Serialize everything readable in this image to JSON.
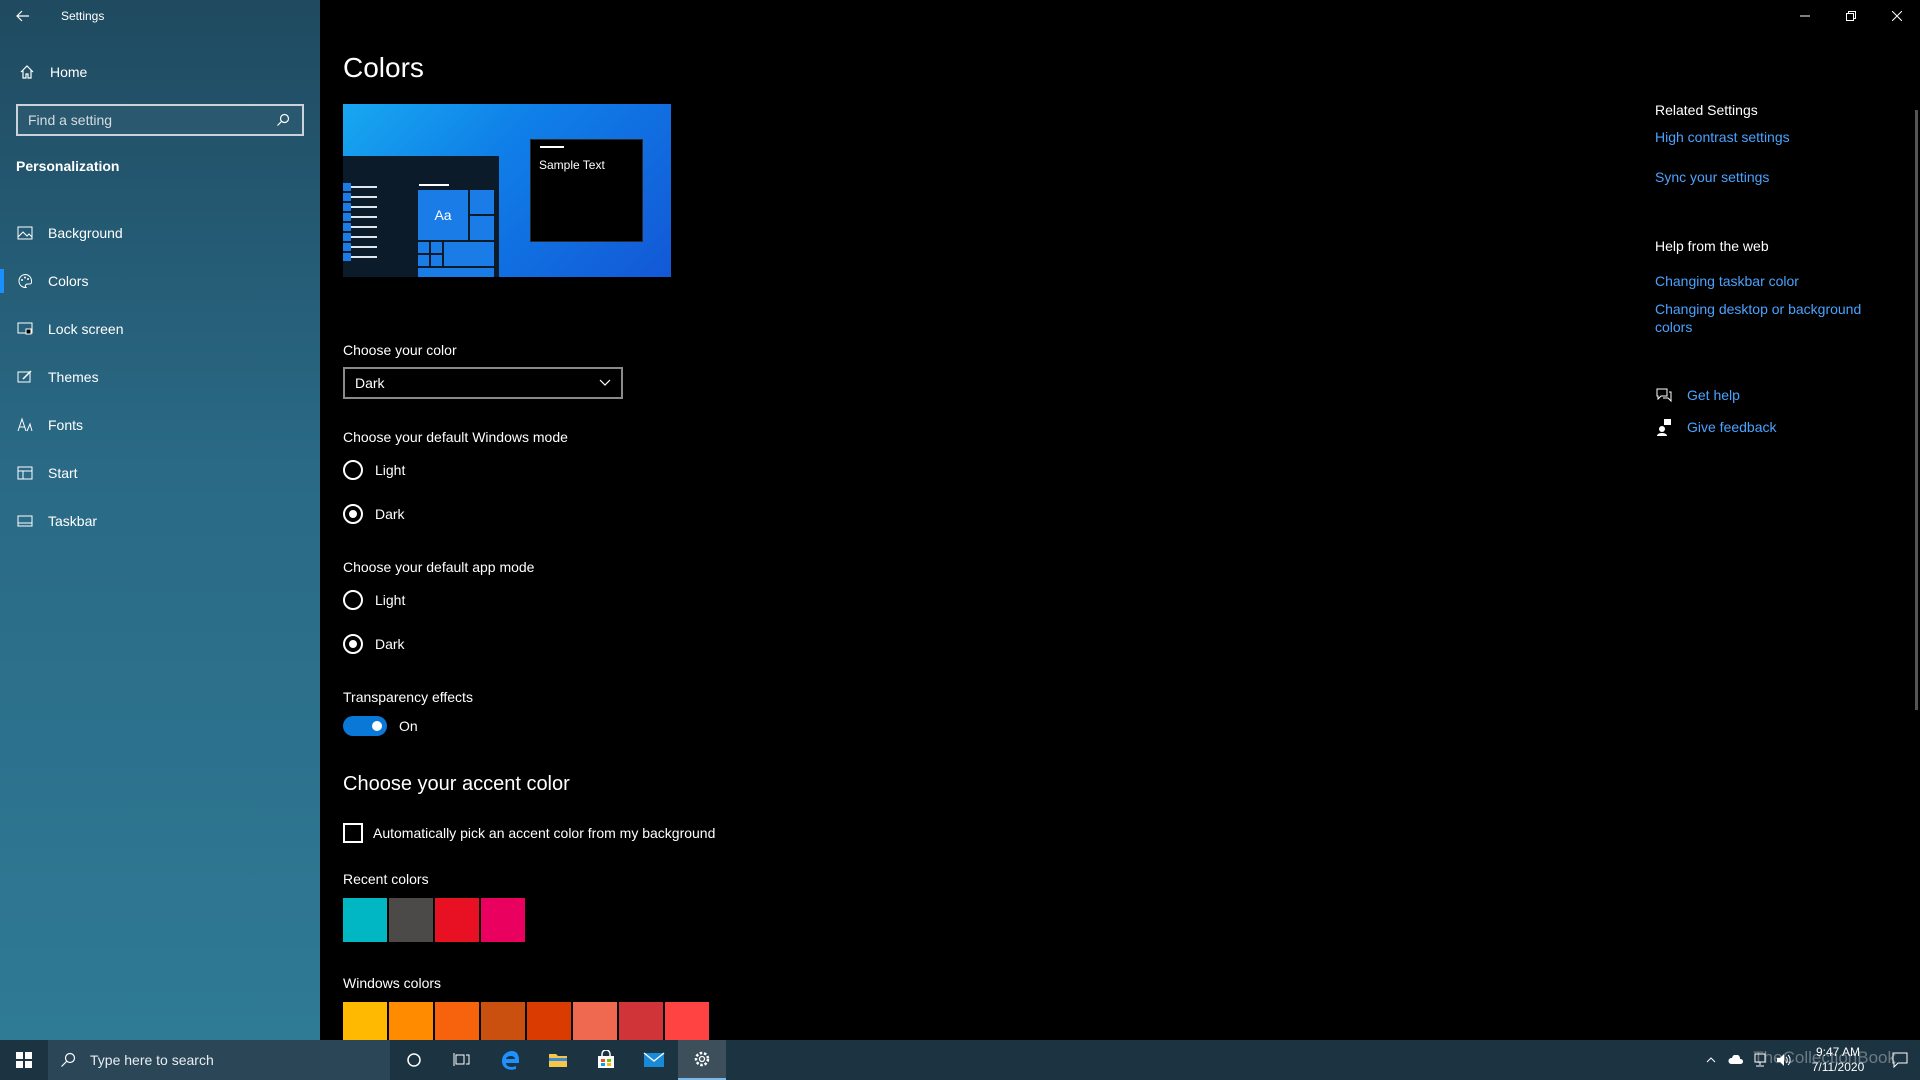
{
  "window": {
    "title": "Settings"
  },
  "sidebar": {
    "home_label": "Home",
    "search_placeholder": "Find a setting",
    "section": "Personalization",
    "items": [
      {
        "label": "Background",
        "icon": "picture-icon"
      },
      {
        "label": "Colors",
        "icon": "palette-icon",
        "active": true
      },
      {
        "label": "Lock screen",
        "icon": "lock-screen-icon"
      },
      {
        "label": "Themes",
        "icon": "brush-icon"
      },
      {
        "label": "Fonts",
        "icon": "font-icon"
      },
      {
        "label": "Start",
        "icon": "start-icon"
      },
      {
        "label": "Taskbar",
        "icon": "taskbar-icon"
      }
    ]
  },
  "main": {
    "title": "Colors",
    "preview": {
      "sample_text": "Sample Text",
      "tile_text": "Aa"
    },
    "choose_color_label": "Choose your color",
    "choose_color_value": "Dark",
    "windows_mode": {
      "label": "Choose your default Windows mode",
      "options": [
        "Light",
        "Dark"
      ],
      "selected": "Dark"
    },
    "app_mode": {
      "label": "Choose your default app mode",
      "options": [
        "Light",
        "Dark"
      ],
      "selected": "Dark"
    },
    "transparency": {
      "label": "Transparency effects",
      "state": "On"
    },
    "accent_heading": "Choose your accent color",
    "auto_accent_label": "Automatically pick an accent color from my background",
    "recent_colors_label": "Recent colors",
    "recent_colors": [
      "#00b7c3",
      "#4c4a48",
      "#e81123",
      "#ea005e"
    ],
    "windows_colors_label": "Windows colors",
    "windows_colors": [
      "#ffb900",
      "#ff8c00",
      "#f7630c",
      "#ca5010",
      "#da3b01",
      "#ef6950",
      "#d13438",
      "#ff4343"
    ]
  },
  "related": {
    "heading": "Related Settings",
    "links": [
      "High contrast settings",
      "Sync your settings"
    ],
    "help_heading": "Help from the web",
    "help_links": [
      "Changing taskbar color",
      "Changing desktop or background colors"
    ],
    "get_help": "Get help",
    "give_feedback": "Give feedback"
  },
  "taskbar": {
    "search_placeholder": "Type here to search",
    "time": "9:47 AM",
    "date": "7/11/2020",
    "watermark": "TheCollectionBook"
  },
  "colors": {
    "accent": "#0a78d7",
    "link": "#4aa3ff"
  }
}
